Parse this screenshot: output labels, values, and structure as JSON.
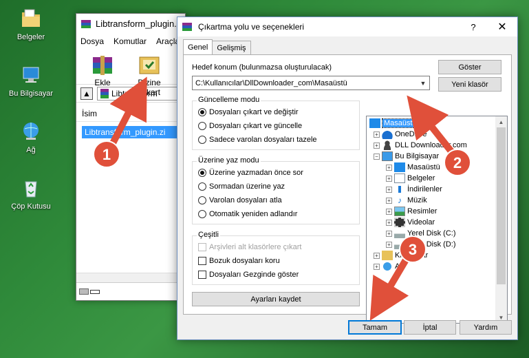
{
  "desktop": {
    "icons": [
      {
        "label": "Belgeler"
      },
      {
        "label": "Bu Bilgisayar"
      },
      {
        "label": "Ağ"
      },
      {
        "label": "Çöp Kutusu"
      }
    ]
  },
  "winrar": {
    "title": "Libtransform_plugin.z",
    "menu": [
      "Dosya",
      "Komutlar",
      "Araçla"
    ],
    "toolbar": [
      "Ekle",
      "Dizine Çıkart"
    ],
    "path": "Libtransform",
    "column_header": "İsim",
    "selected_file": "Libtransform_plugin.zi"
  },
  "dialog": {
    "title": "Çıkartma yolu ve seçenekleri",
    "help_glyph": "?",
    "close_glyph": "✕",
    "tabs": [
      "Genel",
      "Gelişmiş"
    ],
    "dest_label": "Hedef konum (bulunmazsa oluşturulacak)",
    "dest_value": "C:\\Kullanıcılar\\DllDownloader_com\\Masaüstü",
    "btn_show": "Göster",
    "btn_new_folder": "Yeni klasör",
    "update_group": {
      "title": "Güncelleme modu",
      "options": [
        "Dosyaları çıkart ve değiştir",
        "Dosyaları çıkart ve güncelle",
        "Sadece varolan dosyaları tazele"
      ],
      "selected": 0
    },
    "overwrite_group": {
      "title": "Üzerine yaz modu",
      "options": [
        "Üzerine yazmadan önce sor",
        "Sormadan üzerine yaz",
        "Varolan dosyaları atla",
        "Otomatik yeniden adlandır"
      ],
      "selected": 0
    },
    "misc_group": {
      "title": "Çeşitli",
      "options": [
        {
          "label": "Arşivleri alt klasörlere çıkart",
          "checked": false,
          "disabled": true
        },
        {
          "label": "Bozuk dosyaları koru",
          "checked": false,
          "disabled": false
        },
        {
          "label": "Dosyaları Gezginde göster",
          "checked": false,
          "disabled": false
        }
      ]
    },
    "btn_save_settings": "Ayarları kaydet",
    "tree": [
      {
        "label": "Masaüstü",
        "icon": "desktop-icon",
        "selected": true
      },
      {
        "label": "OneDrive",
        "icon": "cloud-icon"
      },
      {
        "label": "DLL Downloader.com",
        "icon": "user-icon"
      },
      {
        "label": "Bu Bilgisayar",
        "icon": "computer-icon"
      },
      {
        "label": "Masaüstü",
        "icon": "desktop-icon"
      },
      {
        "label": "Belgeler",
        "icon": "documents-icon"
      },
      {
        "label": "İndirilenler",
        "icon": "download-icon"
      },
      {
        "label": "Müzik",
        "icon": "music-icon"
      },
      {
        "label": "Resimler",
        "icon": "pictures-icon"
      },
      {
        "label": "Videolar",
        "icon": "video-icon"
      },
      {
        "label": "Yerel Disk (C:)",
        "icon": "drive-icon"
      },
      {
        "label": "Yerel Disk (D:)",
        "icon": "drive-icon"
      },
      {
        "label": "Kitaplıklar",
        "icon": "library-icon"
      },
      {
        "label": "Ağ",
        "icon": "network-icon"
      }
    ],
    "btn_ok": "Tamam",
    "btn_cancel": "İptal",
    "btn_help": "Yardım"
  },
  "annotations": {
    "markers": [
      "1",
      "2",
      "3"
    ],
    "arrow_color": "#e0503a"
  }
}
